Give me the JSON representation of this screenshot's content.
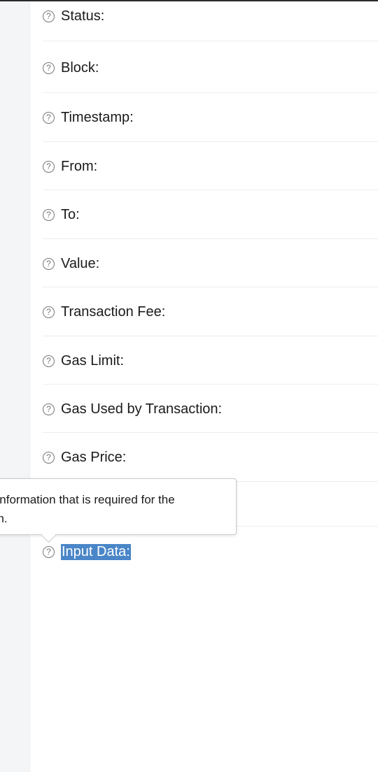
{
  "fields": [
    {
      "label": "Status:"
    },
    {
      "label": "Block:"
    },
    {
      "label": "Timestamp:"
    },
    {
      "label": "From:"
    },
    {
      "label": "To:"
    },
    {
      "label": "Value:"
    },
    {
      "label": "Transaction Fee:"
    },
    {
      "label": "Gas Limit:"
    },
    {
      "label": "Gas Used by Transaction:"
    },
    {
      "label": "Gas Price:"
    },
    {
      "label": "Input Data:"
    }
  ],
  "help_icon": {
    "name": "help-icon",
    "glyph": "?"
  },
  "tooltip": {
    "line1": "l information that is required for the",
    "line2": "on."
  },
  "colors": {
    "selection": "#4a86c8",
    "separator": "#eceef1"
  }
}
